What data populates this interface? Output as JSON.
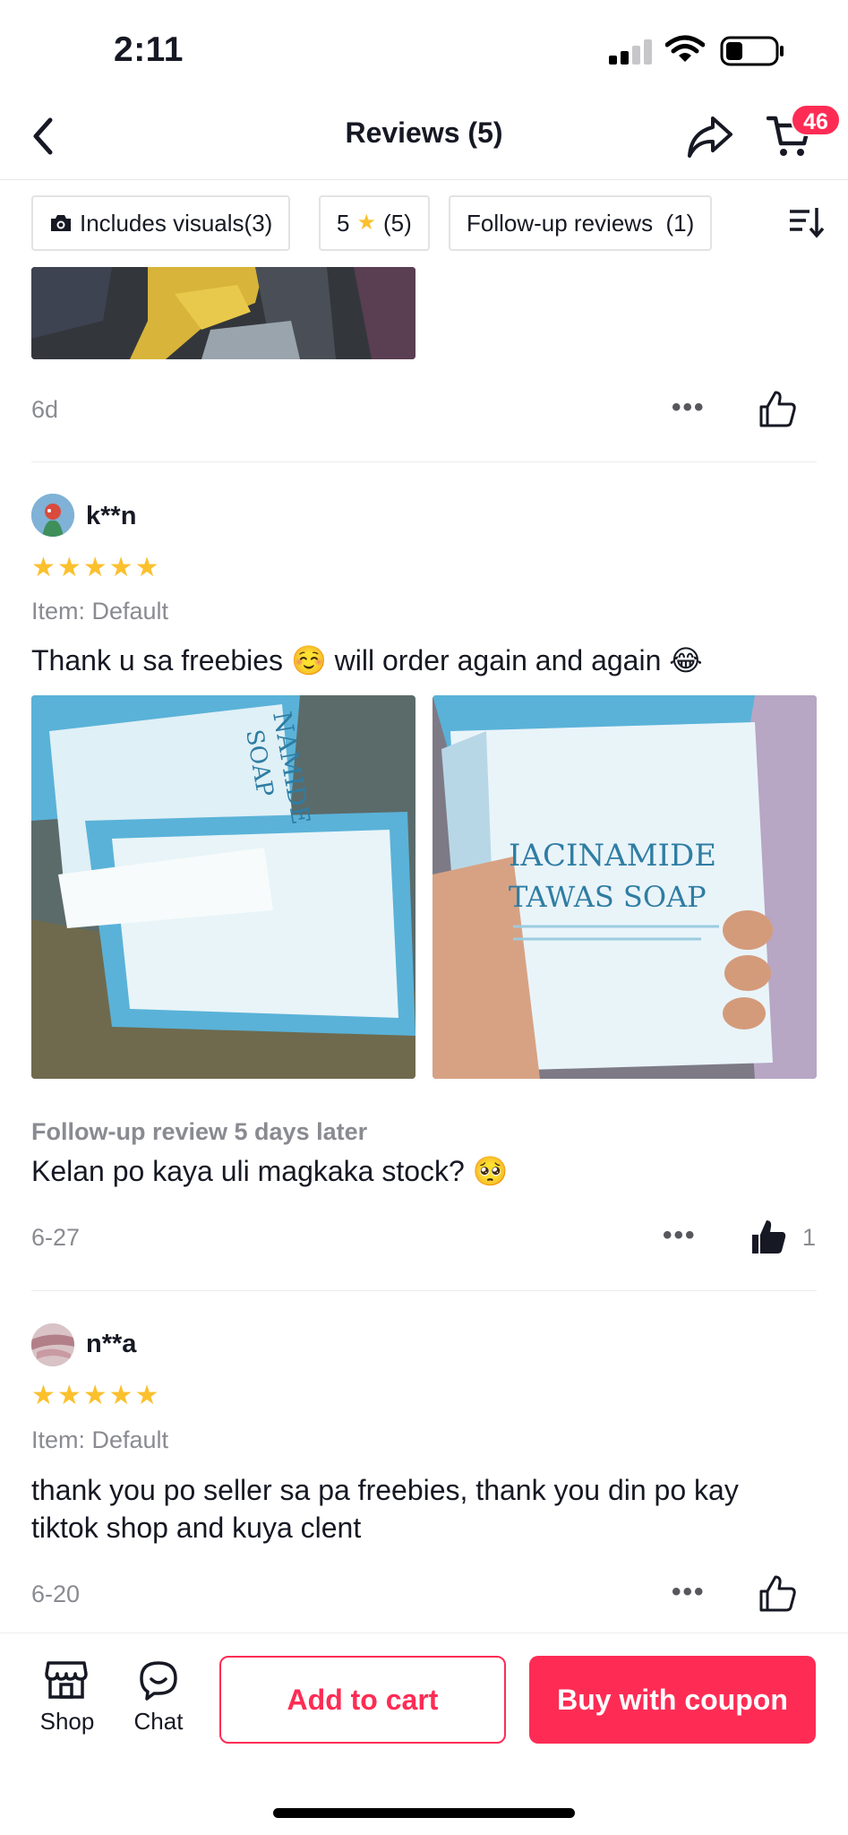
{
  "status_bar": {
    "time": "2:11"
  },
  "header": {
    "title": "Reviews (5)",
    "cart_count": "46"
  },
  "filters": [
    {
      "label": "Includes visuals(3)",
      "icon": "camera-icon"
    },
    {
      "label_prefix": "5",
      "label_suffix": "(5)",
      "icon": "star-icon"
    },
    {
      "label": "Follow-up reviews  (1)"
    }
  ],
  "reviews": [
    {
      "date": "6d",
      "liked": false,
      "like_count": ""
    },
    {
      "username": "k**n",
      "stars": "★★★★★",
      "item": "Item: Default",
      "text": "Thank u sa freebies ☺️ will order again and again 😂",
      "photo_captions": [
        {
          "line1": "NAMIDE",
          "line2": "SOAP"
        },
        {
          "line1": "IACINAMIDE",
          "line2": "TAWAS SOAP"
        }
      ],
      "followup_label": "Follow-up review 5 days later",
      "followup_text": "Kelan po kaya uli magkaka stock? 🥺",
      "date": "6-27",
      "liked": true,
      "like_count": "1"
    },
    {
      "username": "n**a",
      "stars": "★★★★★",
      "item": "Item: Default",
      "text": "thank you po seller sa pa freebies, thank you din po kay tiktok shop and kuya clent",
      "date": "6-20",
      "liked": false,
      "like_count": ""
    }
  ],
  "more_glyph": "•••",
  "bottom_bar": {
    "shop_label": "Shop",
    "chat_label": "Chat",
    "add_to_cart": "Add to cart",
    "buy_with_coupon": "Buy with coupon"
  },
  "colors": {
    "accent": "#fe2c55",
    "star": "#fbc02d",
    "muted": "#8a8b91"
  }
}
